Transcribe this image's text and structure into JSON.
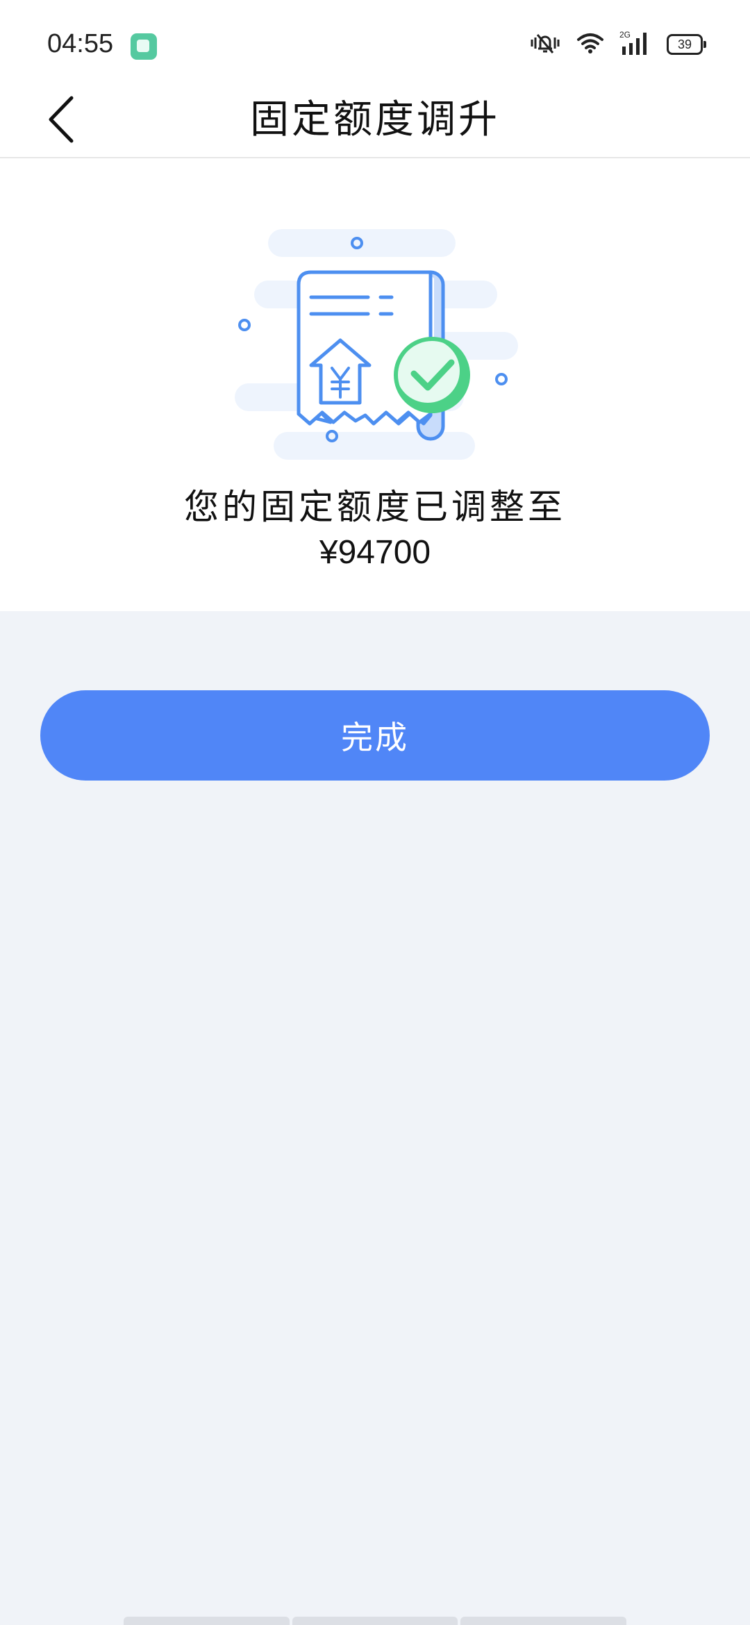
{
  "status_bar": {
    "time": "04:55",
    "network_label": "2G",
    "battery_level": "39",
    "icons": [
      "app-notification-icon",
      "vibrate-mute-icon",
      "wifi-icon",
      "signal-icon",
      "battery-icon"
    ]
  },
  "header": {
    "title": "固定额度调升",
    "back_icon": "chevron-left-icon"
  },
  "result": {
    "illustration": "receipt-success-illustration",
    "message": "您的固定额度已调整至",
    "amount": "¥94700"
  },
  "actions": {
    "done_label": "完成"
  },
  "colors": {
    "primary": "#5086f7",
    "page_background": "#f0f3f8",
    "success_green": "#4cd187",
    "illustration_blue": "#4d8ff0"
  }
}
